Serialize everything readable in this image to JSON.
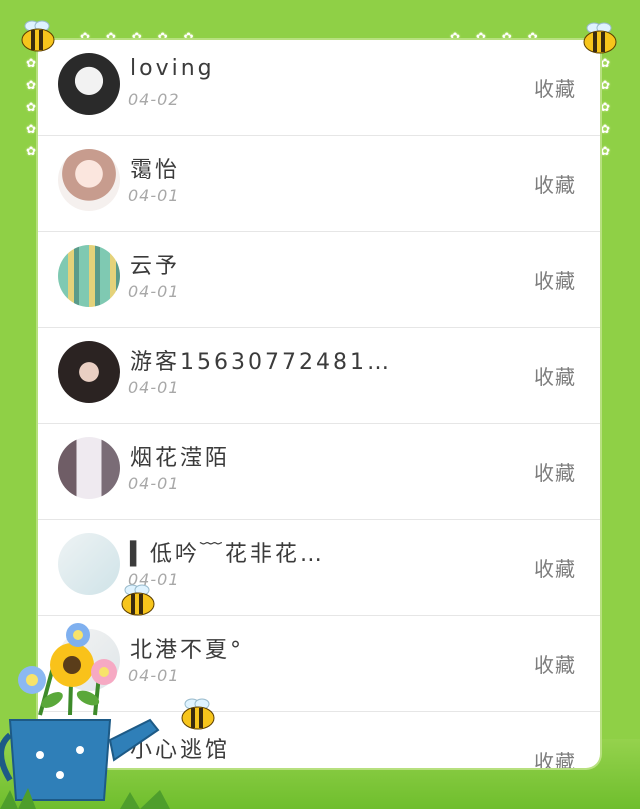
{
  "list": {
    "items": [
      {
        "name": "loving",
        "date": "04-02",
        "fav": "收藏",
        "avatar": "dark"
      },
      {
        "name": "霭怡",
        "date": "04-01",
        "fav": "收藏",
        "avatar": "girl"
      },
      {
        "name": "云予",
        "date": "04-01",
        "fav": "收藏",
        "avatar": "group"
      },
      {
        "name": "游客15630772481…",
        "date": "04-01",
        "fav": "收藏",
        "avatar": "portrait"
      },
      {
        "name": "烟花滢陌",
        "date": "04-01",
        "fav": "收藏",
        "avatar": "shirt"
      },
      {
        "name": "▍低吟﹋花非花…",
        "date": "04-01",
        "fav": "收藏",
        "avatar": "pale"
      },
      {
        "name": "北港不夏°",
        "date": "04-01",
        "fav": "收藏",
        "avatar": "pale2"
      },
      {
        "name": "小心逃馆",
        "date": "",
        "fav": "收藏",
        "avatar": "none"
      }
    ]
  },
  "colors": {
    "background": "#8fd046",
    "card": "#ffffff",
    "text": "#3b3b3b",
    "muted": "#a8a8a8"
  },
  "decor": {
    "bee": "bee-icon",
    "flower_pot": "flower-pot-icon",
    "daisy": "daisy-icon"
  }
}
